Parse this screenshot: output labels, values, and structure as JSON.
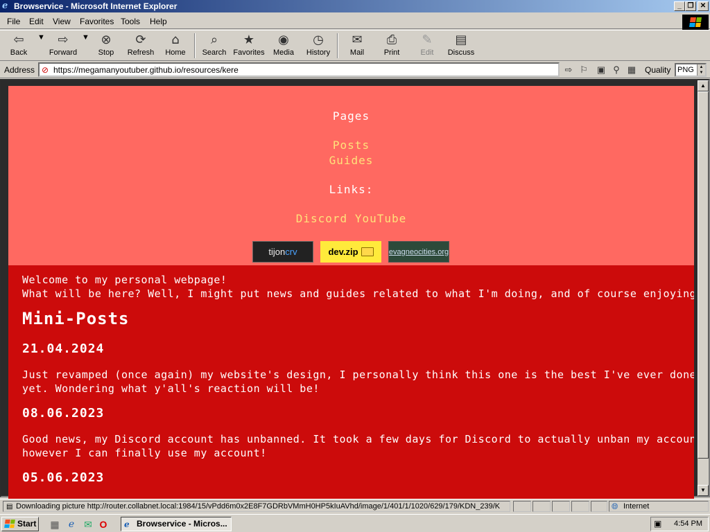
{
  "window": {
    "title": "Browservice - Microsoft Internet Explorer"
  },
  "menu": [
    "File",
    "Edit",
    "View",
    "Favorites",
    "Tools",
    "Help"
  ],
  "toolbar": {
    "back": "Back",
    "forward": "Forward",
    "stop": "Stop",
    "refresh": "Refresh",
    "home": "Home",
    "search": "Search",
    "favorites": "Favorites",
    "media": "Media",
    "history": "History",
    "mail": "Mail",
    "print": "Print",
    "edit": "Edit",
    "discuss": "Discuss"
  },
  "address": {
    "label": "Address",
    "url": "https://megamanyoutuber.github.io/resources/kere"
  },
  "quality": {
    "label": "Quality",
    "value": "PNG"
  },
  "site": {
    "nav": {
      "pages_label": "Pages",
      "posts": "Posts",
      "guides": "Guides",
      "links_label": "Links:",
      "discord": "Discord",
      "youtube": "YouTube"
    },
    "badges": {
      "tijon_a": "tijon",
      "tijon_b": "crv",
      "devzip": "dev.zip",
      "neo": "evagneocities.org"
    },
    "welcome_line1": "Welcome to my personal webpage!",
    "welcome_line2": "What will be here? Well, I might put news and guides related to what I'm doing, and of course enjoying!",
    "mini_posts_title": "Mini-Posts",
    "posts": [
      {
        "date": "21.04.2024",
        "line1": "Just revamped (once again) my website's design, I personally think this one is the best I've ever done",
        "line2": "yet. Wondering what y'all's reaction will be!"
      },
      {
        "date": "08.06.2023",
        "line1": "Good news, my Discord account has unbanned. It took a few days for Discord to actually unban my account,",
        "line2": "however I can finally use my account!"
      },
      {
        "date": "05.06.2023"
      }
    ]
  },
  "status": {
    "text": "Downloading picture http://router.collabnet.local:1984/15/vPdd6m0x2E8F7GDRbVMmH0HP5kIuAVhd/image/1/401/1/1020/629/179/KDN_239/K",
    "zone": "Internet"
  },
  "taskbar": {
    "start": "Start",
    "task": "Browservice - Micros...",
    "clock": "4:54 PM"
  },
  "colors": {
    "header_bg": "#ff6961",
    "content_bg": "#cc0b0b",
    "link_yellow": "#ffe27a"
  }
}
